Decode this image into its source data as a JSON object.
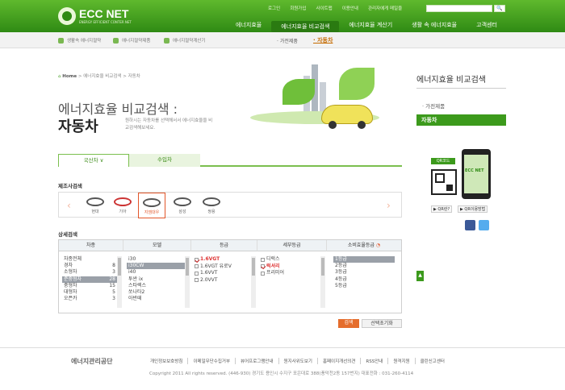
{
  "header": {
    "logo_title": "ECC NET",
    "logo_sub": "ENERGY EFFICIENT CONTER NET",
    "util_links": [
      "로그인",
      "회원가입",
      "사이트맵",
      "이용안내",
      "관리자에게 메일을"
    ],
    "search_button": "🔍",
    "gnb": [
      "에너지효율",
      "에너지효율 비교검색",
      "에너지효율 계산기",
      "생활 속 에너지효율",
      "고객센터"
    ]
  },
  "subnav": {
    "quick": [
      "생활속 에너지절약",
      "에너지절약제품",
      "에너지절약계산기"
    ],
    "current_parent": "· 가전제품",
    "current": "· 자동차"
  },
  "breadcrumb": {
    "home": "Home",
    "path": "에너지효율 비교검색 > 자동차"
  },
  "title": {
    "line1": "에너지효율 비교검색 :",
    "line2": "자동차",
    "desc": "원하시는 자동차를 선택해서서 에너지효율을 비교검색해보세요."
  },
  "tabs": [
    "국산차 ∨",
    "수입차"
  ],
  "maker_section": {
    "label": "제조사검색",
    "makers": [
      {
        "name": "현대",
        "selected": false
      },
      {
        "name": "기아",
        "selected": false
      },
      {
        "name": "지엠대우",
        "selected": true
      },
      {
        "name": "삼성",
        "selected": false
      },
      {
        "name": "쌍용",
        "selected": false
      }
    ]
  },
  "detail_section": {
    "label": "상세검색"
  },
  "grid": {
    "headers": [
      "차종",
      "모델",
      "등급",
      "세부등급",
      "소비효율등급"
    ],
    "vehicle_types": [
      {
        "name": "차종전체",
        "count": ""
      },
      {
        "name": "경차",
        "count": "8"
      },
      {
        "name": "소형차",
        "count": "3"
      },
      {
        "name": "준중형차",
        "count": "28"
      },
      {
        "name": "중형차",
        "count": "15"
      },
      {
        "name": "대형차",
        "count": "5"
      },
      {
        "name": "오픈카",
        "count": "3"
      }
    ],
    "models": [
      "i30",
      "i30CW",
      "i40",
      "투싼 ix",
      "스타렉스",
      "쏘나타2",
      "아반떼"
    ],
    "grades": [
      {
        "name": "1.6VGT",
        "checked": true
      },
      {
        "name": "1.6VGT 유로V",
        "checked": false
      },
      {
        "name": "1.6VVT",
        "checked": false
      },
      {
        "name": "2.0VVT",
        "checked": false
      }
    ],
    "sub_grades": [
      {
        "name": "디럭스",
        "checked": false
      },
      {
        "name": "럭셔리",
        "checked": true
      },
      {
        "name": "프리미어",
        "checked": false
      }
    ],
    "efficiency": [
      "1등급",
      "2등급",
      "3등급",
      "4등급",
      "5등급"
    ]
  },
  "buttons": {
    "search": "검색",
    "reset": "선택초기화"
  },
  "right": {
    "title": "에너지효율 비교검색",
    "menu1": "· 가전제품",
    "menu2": "자동차",
    "qr_label": "QR코드",
    "phone_label": "ECC NET",
    "qr_btn1": "▶ QR란?",
    "qr_btn2": "▶ QR이용방법",
    "gotop": "▲"
  },
  "footer": {
    "logo": "에너지관리공단",
    "links": [
      "개인정보보호방침",
      "이메일무단수집거부",
      "뷰어프로그램안내",
      "원지사위도보기",
      "홈페이지개선의견",
      "RSS안내",
      "원격지원",
      "클린신고센터"
    ],
    "copyright": "Copyright 2011 All rights reserved.   (446-930) 경기도 용인시 수지구 포은대로 388(풍덕천2동 157번지) 대표전화 : 031-260-4114"
  },
  "colors": {
    "brand": "#3c9a1c",
    "accent": "#e56d2c",
    "selected_red": "#d33333"
  }
}
